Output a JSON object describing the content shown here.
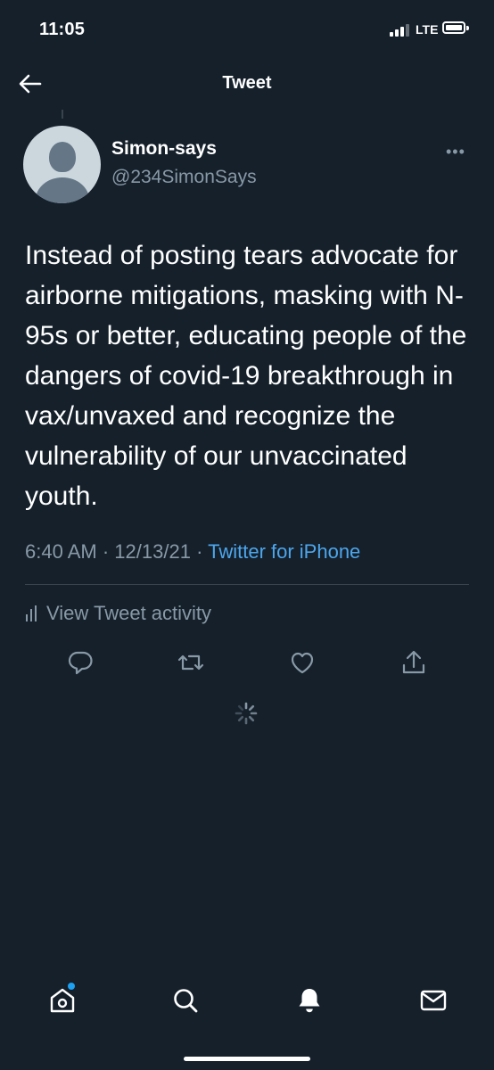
{
  "status_bar": {
    "time": "11:05",
    "network": "LTE"
  },
  "header": {
    "title": "Tweet"
  },
  "tweet": {
    "display_name": "Simon-says",
    "handle": "@234SimonSays",
    "text": "Instead of posting tears advocate for airborne mitigations, masking with N-95s or better, educating people of the dangers of covid-19 breakthrough in vax/unvaxed and recognize the vulnerability of our unvaccinated youth.",
    "time": "6:40 AM",
    "date": "12/13/21",
    "source": "Twitter for iPhone"
  },
  "activity": {
    "label": "View Tweet activity"
  },
  "icons": {
    "back": "arrow-left-icon",
    "more": "more-dots-icon",
    "reply": "reply-icon",
    "retweet": "retweet-icon",
    "like": "heart-icon",
    "share": "share-icon",
    "loading": "spinner-icon",
    "tab_home": "home-icon",
    "tab_search": "search-icon",
    "tab_notifications": "bell-icon",
    "tab_messages": "mail-icon"
  },
  "colors": {
    "background": "#15202b",
    "link": "#4da6ec",
    "muted": "#8899a6",
    "accent": "#1da1f2"
  }
}
